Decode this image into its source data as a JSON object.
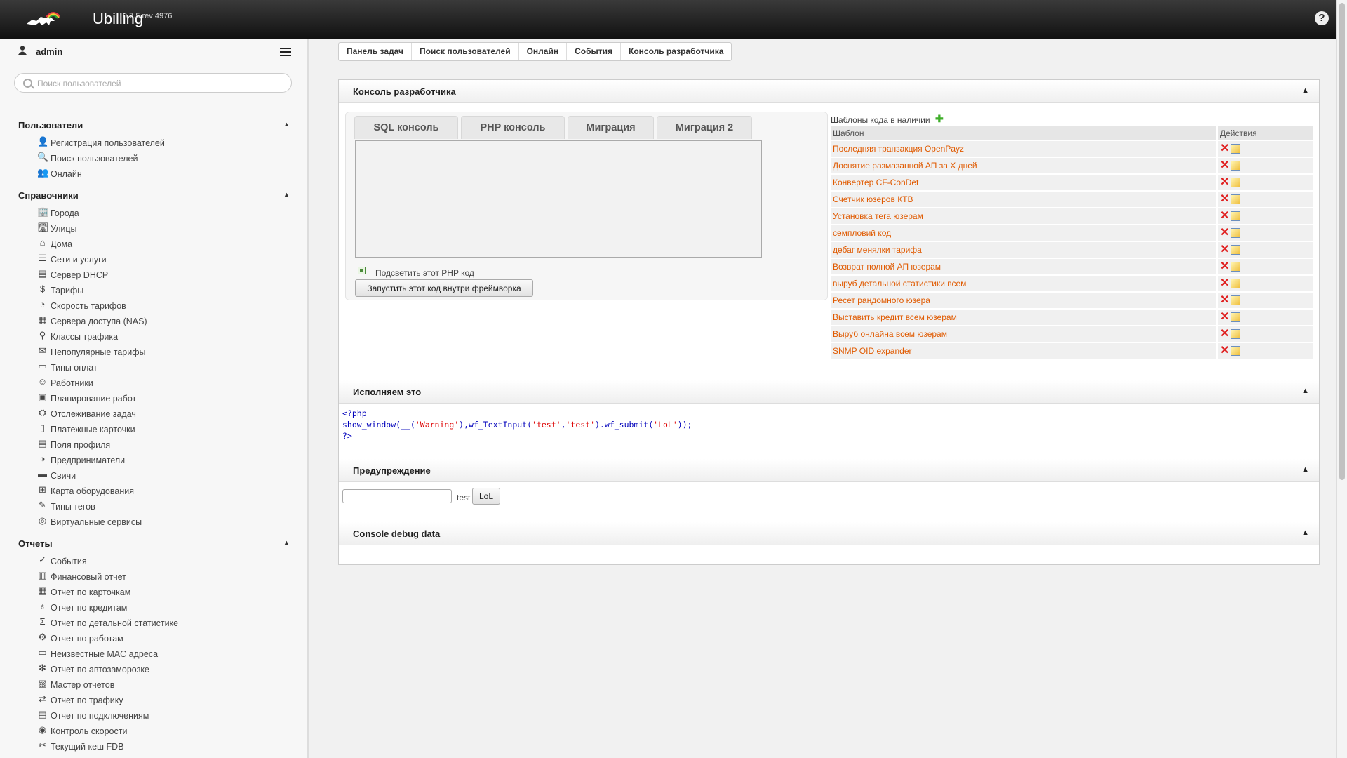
{
  "app": {
    "brand": "Ubilling",
    "version": "0.7.5 rev 4976",
    "help_label": "?"
  },
  "user": {
    "name": "admin"
  },
  "search": {
    "placeholder": "Поиск пользователей"
  },
  "sections": [
    {
      "title": "Пользователи",
      "items": [
        {
          "label": "Регистрация пользователей",
          "icon": "user-add-icon"
        },
        {
          "label": "Поиск пользователей",
          "icon": "search-icon"
        },
        {
          "label": "Онлайн",
          "icon": "users-online-icon"
        }
      ]
    },
    {
      "title": "Справочники",
      "items": [
        {
          "label": "Города",
          "icon": "city-icon"
        },
        {
          "label": "Улицы",
          "icon": "street-icon"
        },
        {
          "label": "Дома",
          "icon": "house-icon"
        },
        {
          "label": "Сети и услуги",
          "icon": "network-icon"
        },
        {
          "label": "Сервер DHCP",
          "icon": "server-icon"
        },
        {
          "label": "Тарифы",
          "icon": "dollar-icon"
        },
        {
          "label": "Скорость тарифов",
          "icon": "speedometer-icon"
        },
        {
          "label": "Сервера доступа (NAS)",
          "icon": "nas-icon"
        },
        {
          "label": "Классы трафика",
          "icon": "traffic-class-icon"
        },
        {
          "label": "Непопулярные тарифы",
          "icon": "chat-icon"
        },
        {
          "label": "Типы оплат",
          "icon": "payment-type-icon"
        },
        {
          "label": "Работники",
          "icon": "employee-icon"
        },
        {
          "label": "Планирование работ",
          "icon": "clipboard-icon"
        },
        {
          "label": "Отслеживание задач",
          "icon": "task-tracking-icon"
        },
        {
          "label": "Платежные карточки",
          "icon": "card-icon"
        },
        {
          "label": "Поля профиля",
          "icon": "profile-fields-icon"
        },
        {
          "label": "Предприниматели",
          "icon": "pie-icon"
        },
        {
          "label": "Свичи",
          "icon": "switch-icon"
        },
        {
          "label": "Карта оборудования",
          "icon": "map-icon"
        },
        {
          "label": "Типы тегов",
          "icon": "tag-icon"
        },
        {
          "label": "Виртуальные сервисы",
          "icon": "virtual-service-icon"
        }
      ]
    },
    {
      "title": "Отчеты",
      "items": [
        {
          "label": "События",
          "icon": "check-circle-icon"
        },
        {
          "label": "Финансовый отчет",
          "icon": "finance-icon"
        },
        {
          "label": "Отчет по карточкам",
          "icon": "cards-report-icon"
        },
        {
          "label": "Отчет по кредитам",
          "icon": "credit-icon"
        },
        {
          "label": "Отчет по детальной статистике",
          "icon": "sigma-icon"
        },
        {
          "label": "Отчет по работам",
          "icon": "works-icon"
        },
        {
          "label": "Неизвестные MAC адреса",
          "icon": "mac-icon"
        },
        {
          "label": "Отчет по автозаморозке",
          "icon": "snowflake-icon"
        },
        {
          "label": "Мастер отчетов",
          "icon": "report-master-icon"
        },
        {
          "label": "Отчет по трафику",
          "icon": "traffic-icon"
        },
        {
          "label": "Отчет по подключениям",
          "icon": "connections-icon"
        },
        {
          "label": "Контроль скорости",
          "icon": "speed-control-icon"
        },
        {
          "label": "Текущий кеш FDB",
          "icon": "fdb-icon"
        }
      ]
    }
  ],
  "breadcrumbs": [
    "Панель задач",
    "Поиск пользователей",
    "Онлайн",
    "События",
    "Консоль разработчика"
  ],
  "console": {
    "title": "Консоль разработчика",
    "tabs": [
      "SQL консоль",
      "PHP консоль",
      "Миграция",
      "Миграция 2"
    ],
    "highlight_label": "Подсветить этот PHP код",
    "run_button": "Запустить этот код внутри фреймворка"
  },
  "templates": {
    "title": "Шаблоны кода в наличии",
    "col_name": "Шаблон",
    "col_actions": "Действия",
    "items": [
      "Последняя транзакция OpenPayz",
      "Доснятие размазанной АП за X дней",
      "Конвертер CF-ConDet",
      "Счетчик юзеров КТВ",
      "Установка тега юзерам",
      "семпловий код",
      "дебаг менялки тарифа",
      "Возврат полной АП юзерам",
      "выруб детальной статистики всем",
      "Ресет рандомного юзера",
      "Выставить кредит всем юзерам",
      "Выруб онлайна всем юзерам",
      "SNMP OID expander"
    ]
  },
  "execute": {
    "title": "Исполняем это",
    "code": {
      "line1": "<?php",
      "prefix": "show_window(__(",
      "str1": "'Warning'",
      "mid1": "),wf_TextInput(",
      "str2": "'test'",
      "comma": ",",
      "str3": "'test'",
      "mid2": ").wf_submit(",
      "str4": "'LoL'",
      "suffix": "));",
      "line3": "?>"
    }
  },
  "warning": {
    "title": "Предупреждение",
    "input_label": "test",
    "button": "LoL"
  },
  "debug": {
    "title": "Console debug data"
  }
}
